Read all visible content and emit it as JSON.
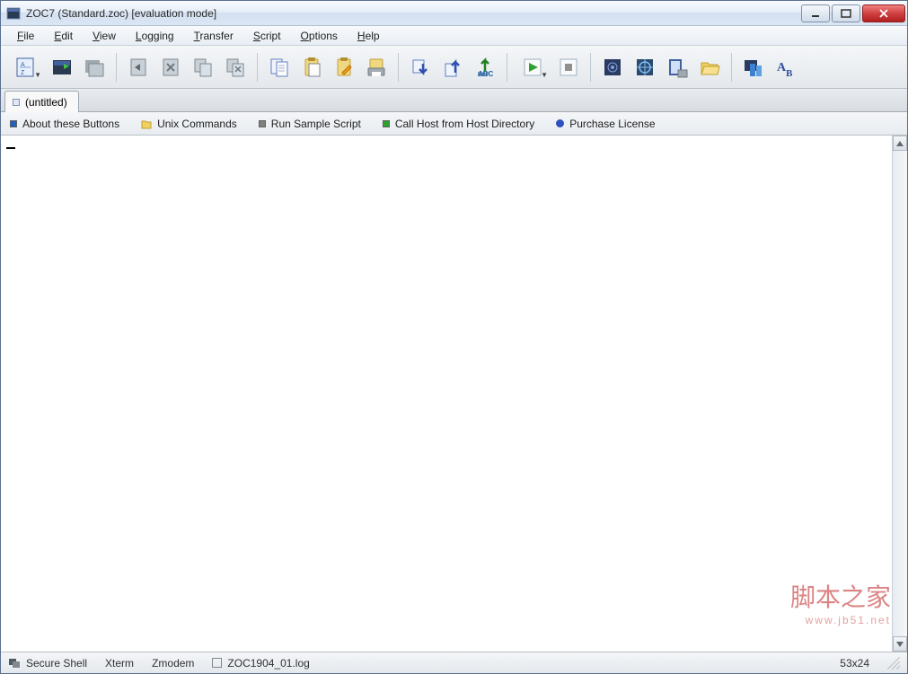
{
  "window": {
    "title": "ZOC7 (Standard.zoc) [evaluation mode]"
  },
  "menu": {
    "file": "File",
    "edit": "Edit",
    "view": "View",
    "logging": "Logging",
    "transfer": "Transfer",
    "script": "Script",
    "options": "Options",
    "help": "Help"
  },
  "toolbar": {
    "host_directory": "Host Directory",
    "quick_connect": "Quick Connection",
    "new_window": "New Window",
    "paste": "Paste",
    "copy": "Copy",
    "clear_selection": "Clear Selection",
    "clear_screen": "Clear Screen",
    "copy_clipboard": "Copy to Clipboard",
    "paste_clipboard": "Paste from Clipboard",
    "edit_clipboard": "Edit Clipboard",
    "print_clipboard": "Print Clipboard",
    "download": "Download",
    "upload": "Upload",
    "text_upload": "Text Upload",
    "start_script": "Start Script",
    "stop_script": "Stop Script",
    "session_profile": "Session Profile",
    "program_settings": "Program Settings",
    "scrollback": "Scrollback Buffer",
    "open_folder": "Open Folder",
    "color_settings": "Color Settings",
    "font_settings": "Font Settings"
  },
  "tab": {
    "label": "(untitled)"
  },
  "quickbar": {
    "about": "About these Buttons",
    "unix": "Unix Commands",
    "sample": "Run Sample Script",
    "callhost": "Call Host from Host Directory",
    "purchase": "Purchase License"
  },
  "terminal": {
    "content": ""
  },
  "statusbar": {
    "protocol": "Secure Shell",
    "emulation": "Xterm",
    "transfer": "Zmodem",
    "logfile": "ZOC1904_01.log",
    "size": "53x24"
  },
  "watermark": {
    "text": "脚本之家",
    "url": "www.jb51.net"
  },
  "colors": {
    "blue_icon": "#3060a0",
    "green_icon": "#40a040",
    "orange_icon": "#e0a020",
    "purple_icon": "#6050a0",
    "red_close": "#d04040"
  }
}
